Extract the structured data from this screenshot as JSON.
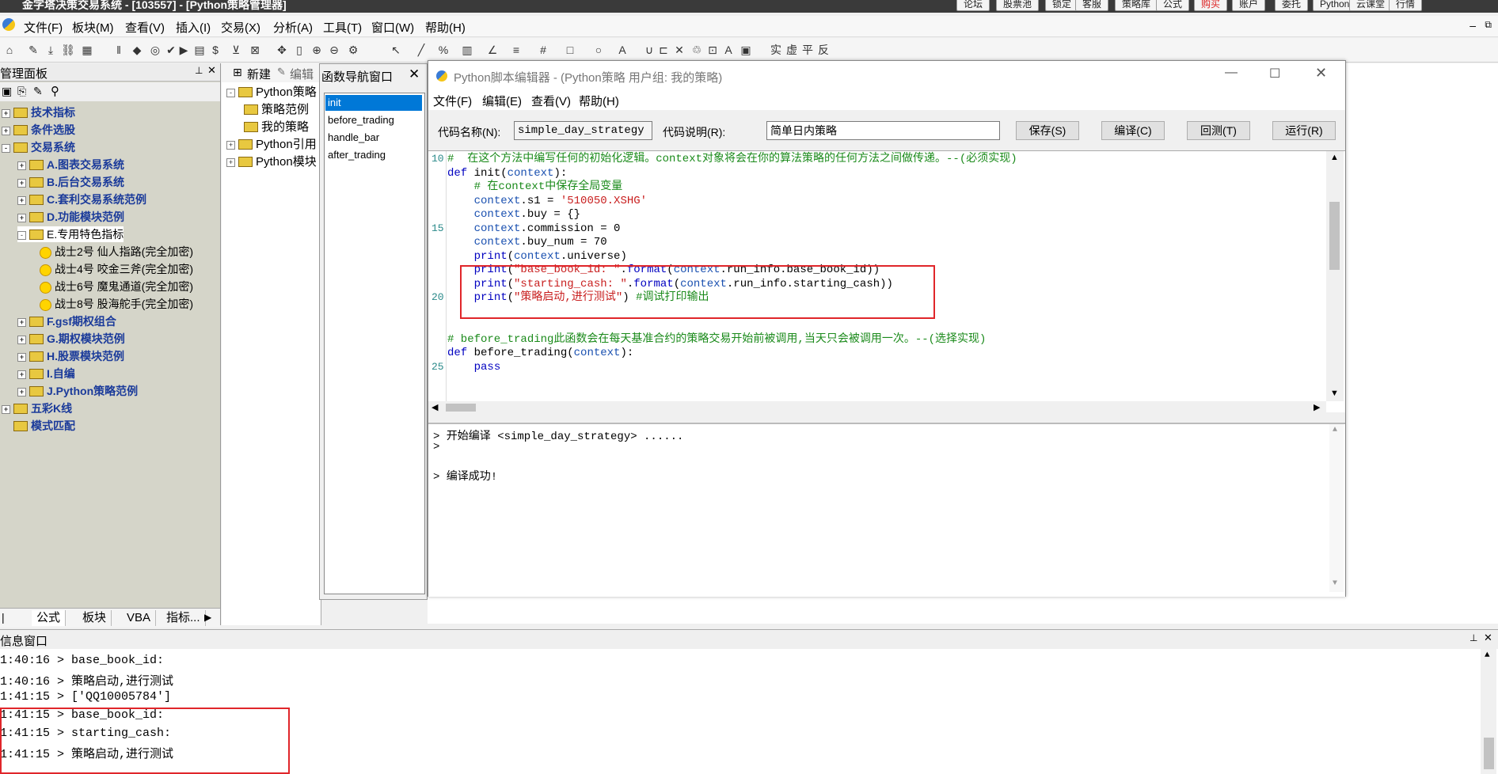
{
  "app": {
    "title": "金字塔决策交易系统 - [103557] - [Python策略管理器]",
    "top_buttons": [
      "论坛",
      "股票池",
      "锁定",
      "客服",
      "策略库",
      "公式",
      "购买",
      "账户",
      "委托",
      "Python",
      "云课堂",
      "行情"
    ]
  },
  "menu": [
    "文件(F)",
    "板块(M)",
    "查看(V)",
    "插入(I)",
    "交易(X)",
    "分析(A)",
    "工具(T)",
    "窗口(W)",
    "帮助(H)"
  ],
  "left_panel": {
    "title": "管理面板",
    "tree": [
      {
        "label": "技术指标",
        "level": 0,
        "kind": "cat",
        "exp": "+"
      },
      {
        "label": "条件选股",
        "level": 0,
        "kind": "cat",
        "exp": "+"
      },
      {
        "label": "交易系统",
        "level": 0,
        "kind": "cat",
        "exp": "-"
      },
      {
        "label": "A.图表交易系统",
        "level": 1,
        "kind": "cat",
        "exp": "+"
      },
      {
        "label": "B.后台交易系统",
        "level": 1,
        "kind": "cat",
        "exp": "+"
      },
      {
        "label": "C.套利交易系统范例",
        "level": 1,
        "kind": "cat",
        "exp": "+"
      },
      {
        "label": "D.功能模块范例",
        "level": 1,
        "kind": "cat",
        "exp": "+"
      },
      {
        "label": "E.专用特色指标",
        "level": 1,
        "kind": "open",
        "exp": "-"
      },
      {
        "label": "战士2号   仙人指路(完全加密)",
        "level": 2,
        "kind": "item",
        "exp": ""
      },
      {
        "label": "战士4号   咬金三斧(完全加密)",
        "level": 2,
        "kind": "item",
        "exp": ""
      },
      {
        "label": "战士6号   魔鬼通道(完全加密)",
        "level": 2,
        "kind": "item",
        "exp": ""
      },
      {
        "label": "战士8号   股海舵手(完全加密)",
        "level": 2,
        "kind": "item",
        "exp": ""
      },
      {
        "label": "F.gsf期权组合",
        "level": 1,
        "kind": "cat",
        "exp": "+"
      },
      {
        "label": "G.期权模块范例",
        "level": 1,
        "kind": "cat",
        "exp": "+"
      },
      {
        "label": "H.股票模块范例",
        "level": 1,
        "kind": "cat",
        "exp": "+"
      },
      {
        "label": "I.自编",
        "level": 1,
        "kind": "cat",
        "exp": "+"
      },
      {
        "label": "J.Python策略范例",
        "level": 1,
        "kind": "cat",
        "exp": "+"
      },
      {
        "label": "五彩K线",
        "level": 0,
        "kind": "cat",
        "exp": "+"
      },
      {
        "label": "模式匹配",
        "level": 0,
        "kind": "cat",
        "exp": ""
      }
    ],
    "tabs": [
      "公式",
      "板块",
      "VBA",
      "指标..."
    ]
  },
  "strategy_panel": {
    "new_label": "新建",
    "edit_label": "编辑",
    "tree": [
      {
        "label": "Python策略",
        "level": 0,
        "exp": "-"
      },
      {
        "label": "策略范例",
        "level": 1,
        "exp": ""
      },
      {
        "label": "我的策略",
        "level": 1,
        "exp": ""
      },
      {
        "label": "Python引用",
        "level": 0,
        "exp": "+"
      },
      {
        "label": "Python模块",
        "level": 0,
        "exp": "+"
      }
    ]
  },
  "func_nav": {
    "title": "函数导航窗口",
    "items": [
      "init",
      "before_trading",
      "handle_bar",
      "after_trading"
    ],
    "selected": 0
  },
  "editor": {
    "title": "Python脚本编辑器 - (Python策略 用户组: 我的策略)",
    "menu": [
      "文件(F)",
      "编辑(E)",
      "查看(V)",
      "帮助(H)"
    ],
    "code_name_label": "代码名称(N):",
    "code_name_value": "simple_day_strategy",
    "code_desc_label": "代码说明(R):",
    "code_desc_value": "简单日内策略",
    "buttons": [
      "保存(S)",
      "编译(C)",
      "回测(T)",
      "运行(R)"
    ],
    "line_numbers": [
      {
        "n": "10",
        "row": 0
      },
      {
        "n": "15",
        "row": 5
      },
      {
        "n": "20",
        "row": 10
      },
      {
        "n": "25",
        "row": 15
      }
    ],
    "code": [
      [
        [
          "cmt",
          "#  在这个方法中编写任何的初始化逻辑。context对象将会在你的算法策略的任何方法之间做传递。--(必须实现)"
        ]
      ],
      [
        [
          "kw",
          "def "
        ],
        [
          "",
          "init("
        ],
        [
          "ctx",
          "context"
        ],
        [
          "",
          "):"
        ]
      ],
      [
        [
          "",
          "    "
        ],
        [
          "cmt",
          "# 在context中保存全局变量"
        ]
      ],
      [
        [
          "",
          "    "
        ],
        [
          "ctx",
          "context"
        ],
        [
          "",
          ".s1 = "
        ],
        [
          "str",
          "'510050.XSHG'"
        ]
      ],
      [
        [
          "",
          "    "
        ],
        [
          "ctx",
          "context"
        ],
        [
          "",
          ".buy = {}"
        ]
      ],
      [
        [
          "",
          "    "
        ],
        [
          "ctx",
          "context"
        ],
        [
          "",
          ".commission = 0"
        ]
      ],
      [
        [
          "",
          "    "
        ],
        [
          "ctx",
          "context"
        ],
        [
          "",
          ".buy_num = 70"
        ]
      ],
      [
        [
          "",
          "    "
        ],
        [
          "kw",
          "print"
        ],
        [
          "",
          "("
        ],
        [
          "ctx",
          "context"
        ],
        [
          "",
          ".universe)"
        ]
      ],
      [
        [
          "",
          "    "
        ],
        [
          "kw",
          "print"
        ],
        [
          "",
          "("
        ],
        [
          "str",
          "\"base_book_id: \""
        ],
        [
          "",
          "."
        ],
        [
          "kw",
          "format"
        ],
        [
          "",
          "("
        ],
        [
          "ctx",
          "context"
        ],
        [
          "",
          ".run_info.base_book_id))"
        ]
      ],
      [
        [
          "",
          "    "
        ],
        [
          "kw",
          "print"
        ],
        [
          "",
          "("
        ],
        [
          "str",
          "\"starting_cash: \""
        ],
        [
          "",
          "."
        ],
        [
          "kw",
          "format"
        ],
        [
          "",
          "("
        ],
        [
          "ctx",
          "context"
        ],
        [
          "",
          ".run_info.starting_cash))"
        ]
      ],
      [
        [
          "",
          "    "
        ],
        [
          "kw",
          "print"
        ],
        [
          "",
          "("
        ],
        [
          "str",
          "\"策略启动,进行测试\""
        ],
        [
          "",
          ") "
        ],
        [
          "cmt",
          "#调试打印输出"
        ]
      ],
      [
        [
          "",
          ""
        ]
      ],
      [
        [
          "",
          ""
        ]
      ],
      [
        [
          "cmt",
          "# before_trading此函数会在每天基准合约的策略交易开始前被调用,当天只会被调用一次。--(选择实现)"
        ]
      ],
      [
        [
          "kw",
          "def "
        ],
        [
          "",
          "before_trading("
        ],
        [
          "ctx",
          "context"
        ],
        [
          "",
          "):"
        ]
      ],
      [
        [
          "",
          "    "
        ],
        [
          "kw",
          "pass"
        ]
      ]
    ],
    "output": [
      "> 开始编译 <simple_day_strategy> ......",
      ">",
      "",
      "> 编译成功!"
    ]
  },
  "info": {
    "title": "信息窗口",
    "lines": [
      "1:40:16 > base_book_id:",
      "1:40:16 > 策略启动,进行测试",
      "1:41:15 > ['QQ10005784']",
      "1:41:15 > base_book_id:",
      "1:41:15 > starting_cash:",
      "1:41:15 > 策略启动,进行测试"
    ]
  }
}
